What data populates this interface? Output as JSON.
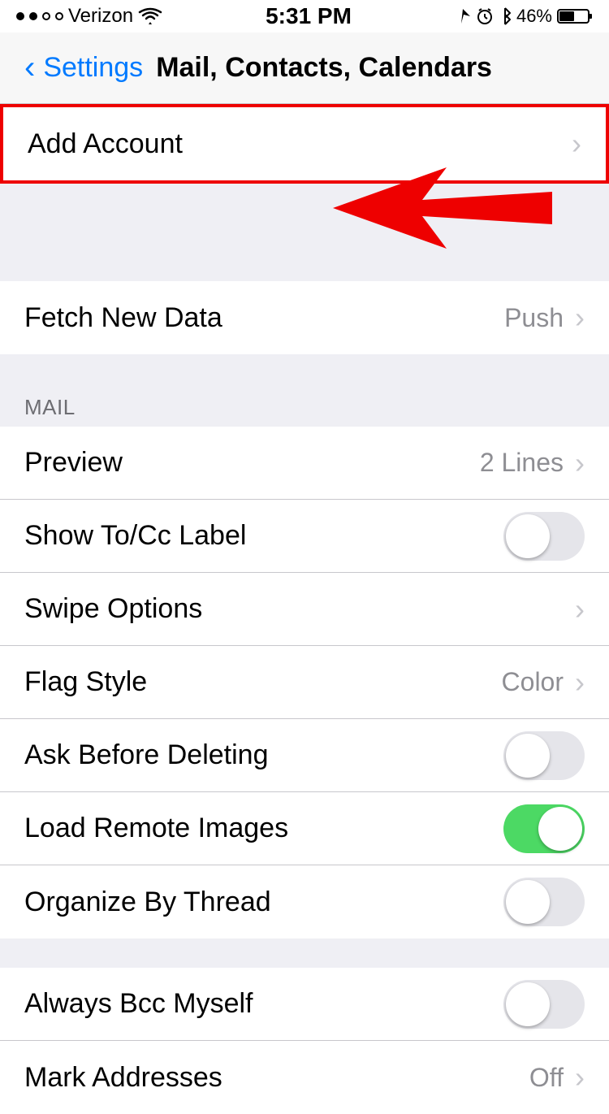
{
  "statusBar": {
    "carrier": "Verizon",
    "time": "5:31 PM",
    "battery": "46%"
  },
  "navBar": {
    "backLabel": "Settings",
    "title": "Mail, Contacts, Calendars"
  },
  "addAccount": {
    "label": "Add Account"
  },
  "fetchRow": {
    "label": "Fetch New Data",
    "value": "Push"
  },
  "mailSection": {
    "header": "MAIL",
    "rows": [
      {
        "label": "Preview",
        "type": "value-chevron",
        "value": "2 Lines"
      },
      {
        "label": "Show To/Cc Label",
        "type": "toggle",
        "on": false
      },
      {
        "label": "Swipe Options",
        "type": "chevron"
      },
      {
        "label": "Flag Style",
        "type": "value-chevron",
        "value": "Color"
      },
      {
        "label": "Ask Before Deleting",
        "type": "toggle",
        "on": false
      },
      {
        "label": "Load Remote Images",
        "type": "toggle",
        "on": true
      },
      {
        "label": "Organize By Thread",
        "type": "toggle",
        "on": false
      }
    ]
  },
  "composingSection": {
    "rows": [
      {
        "label": "Always Bcc Myself",
        "type": "toggle",
        "on": false
      },
      {
        "label": "Mark Addresses",
        "type": "value-chevron",
        "value": "Off"
      }
    ]
  }
}
